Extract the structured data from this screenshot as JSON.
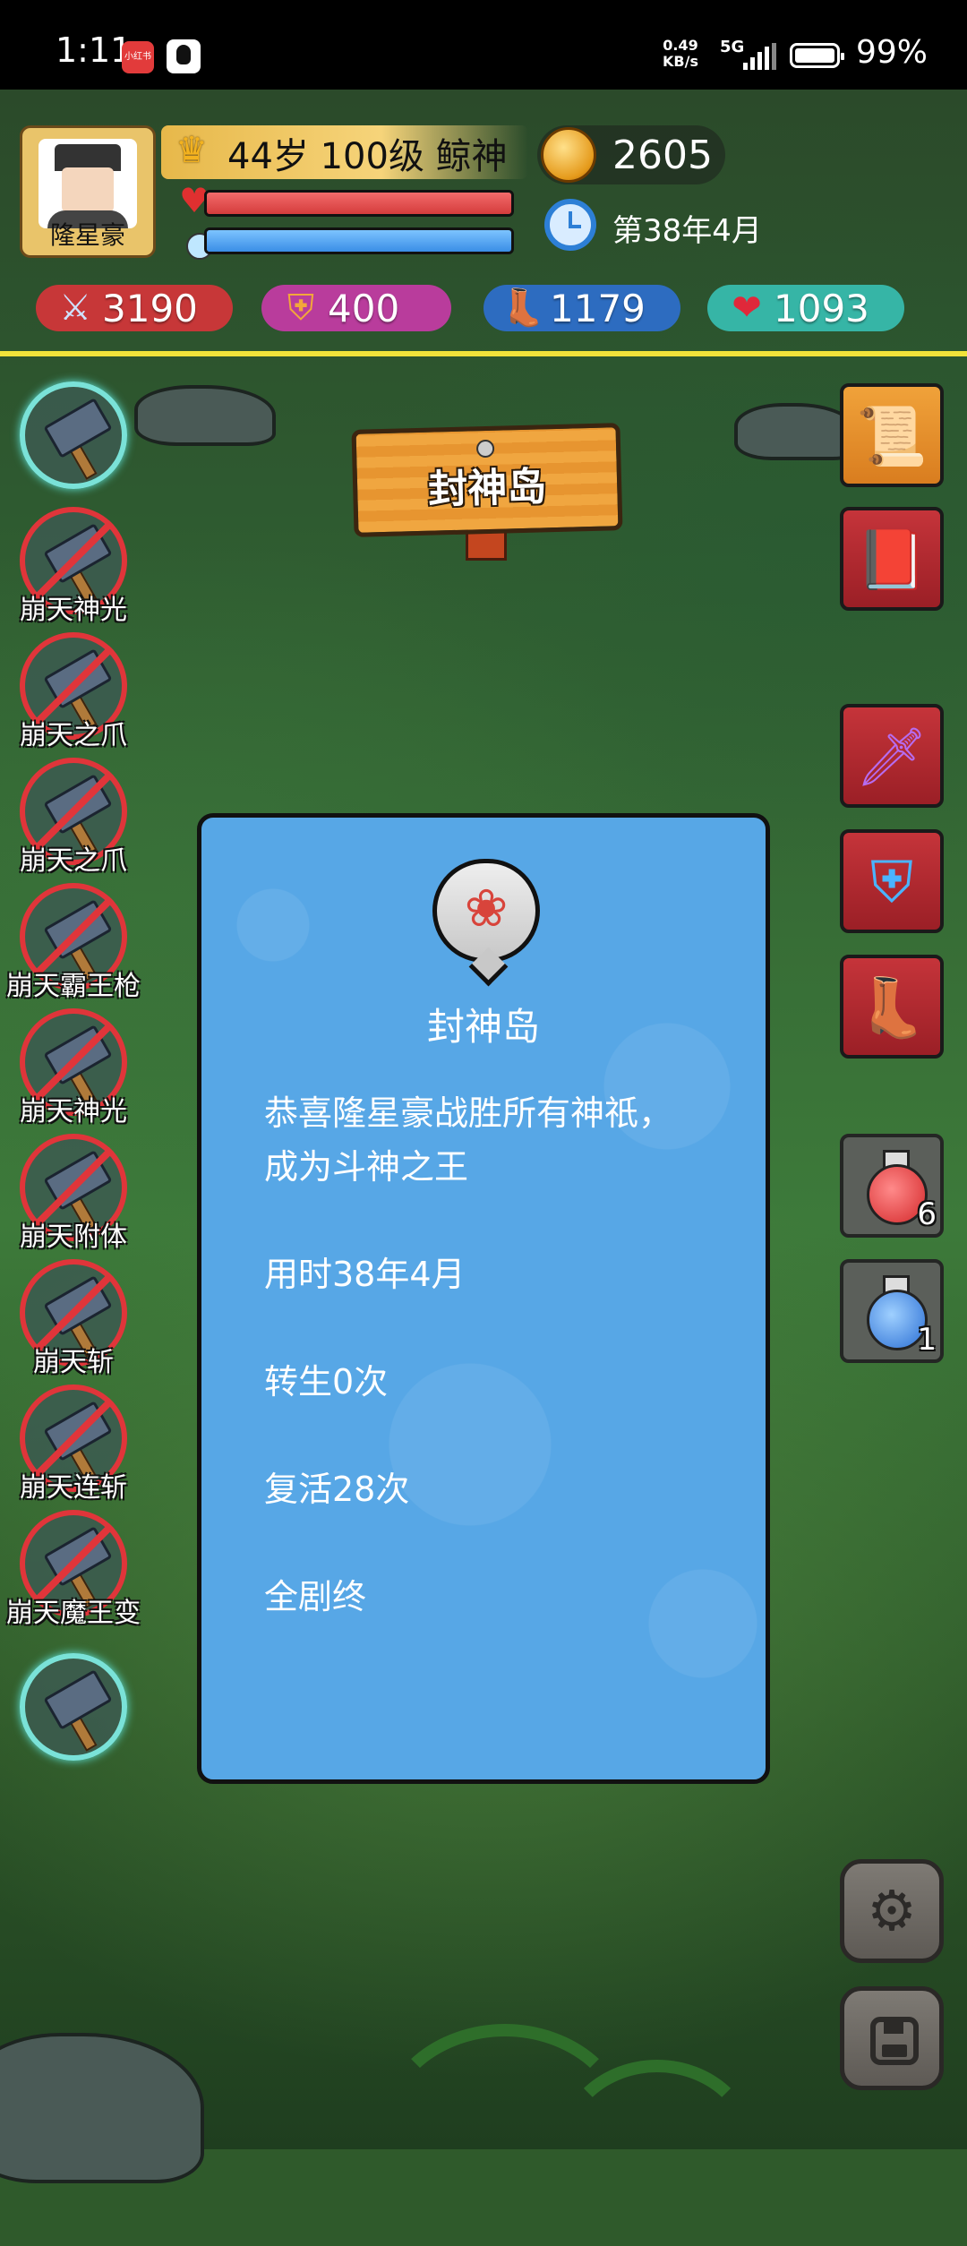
{
  "status_bar": {
    "time": "1:11",
    "app1_label": "小红书",
    "net_speed_value": "0.49",
    "net_speed_unit": "KB/s",
    "network": "5G",
    "battery": "99%"
  },
  "hud": {
    "player_name": "隆星豪",
    "age_level_title": "44岁 100级 鲸神",
    "coins": "2605",
    "date": "第38年4月",
    "hp_fraction": 1.0,
    "mp_fraction": 1.0,
    "stats": [
      {
        "icon": "sword-icon",
        "value": "3190",
        "color": "#d8343a"
      },
      {
        "icon": "shield-icon",
        "value": "400",
        "color": "#c93aa8"
      },
      {
        "icon": "boot-icon",
        "value": "1179",
        "color": "#2e6fd0"
      },
      {
        "icon": "heart-plus-icon",
        "value": "1093",
        "color": "#37c0b4"
      }
    ]
  },
  "location": {
    "name": "封神岛"
  },
  "skills": [
    {
      "label": "",
      "state": "active"
    },
    {
      "label": "崩天神光",
      "state": "locked"
    },
    {
      "label": "崩天之爪",
      "state": "locked"
    },
    {
      "label": "崩天之爪",
      "state": "locked"
    },
    {
      "label": "崩天霸王枪",
      "state": "locked"
    },
    {
      "label": "崩天神光",
      "state": "locked"
    },
    {
      "label": "崩天附体",
      "state": "locked"
    },
    {
      "label": "崩天斩",
      "state": "locked"
    },
    {
      "label": "崩天连斩",
      "state": "locked"
    },
    {
      "label": "崩天魔王变",
      "state": "locked"
    },
    {
      "label": "",
      "state": "active"
    }
  ],
  "items": {
    "map_icon": "map-scroll-icon",
    "book_icon": "book-icon",
    "weapon_icon": "sword-icon",
    "armor_icon": "armor-icon",
    "boots_icon": "boots-icon",
    "hp_potion_count": "6",
    "mp_potion_count": "1"
  },
  "dialog": {
    "title": "封神岛",
    "lines": [
      "恭喜隆星豪战胜所有神祇，",
      "成为斗神之王",
      "用时38年4月",
      "转生0次",
      "复活28次",
      "全剧终"
    ]
  }
}
